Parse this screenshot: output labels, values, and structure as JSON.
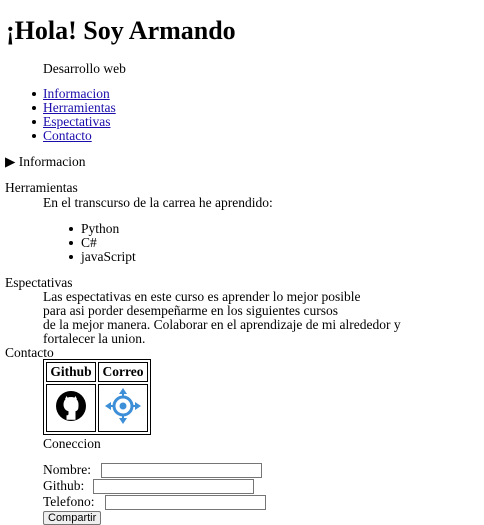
{
  "header": {
    "title": "¡Hola! Soy Armando",
    "subtitle": "Desarrollo web"
  },
  "nav": {
    "items": [
      "Informacion",
      "Herramientas",
      "Espectativas",
      "Contacto"
    ]
  },
  "details": {
    "marker": "▶",
    "summary": "Informacion"
  },
  "herramientas": {
    "heading": "Herramientas",
    "intro": "En el transcurso de la carrea he aprendido:",
    "items": [
      "Python",
      "C#",
      "javaScript"
    ]
  },
  "espectativas": {
    "heading": "Espectativas",
    "lines": [
      "Las espectativas en este curso es aprender lo mejor posible",
      "para asi porder desempeñarme en los siguientes cursos",
      "de la mejor manera. Colaborar en el aprendizaje de mi alrededor y",
      "fortalecer la union."
    ]
  },
  "contacto": {
    "heading": "Contacto",
    "table_headers": [
      "Github",
      "Correo"
    ],
    "icons": [
      "github-icon",
      "correo-icon"
    ],
    "colors": {
      "correo_icon": "#3d8fd8"
    }
  },
  "form": {
    "heading": "Coneccion",
    "fields": [
      {
        "label": "Nombre:",
        "value": ""
      },
      {
        "label": "Github:",
        "value": ""
      },
      {
        "label": "Telefono:",
        "value": ""
      }
    ],
    "submit_label": "Compartir"
  },
  "colors": {
    "link": "#1a0dab"
  }
}
